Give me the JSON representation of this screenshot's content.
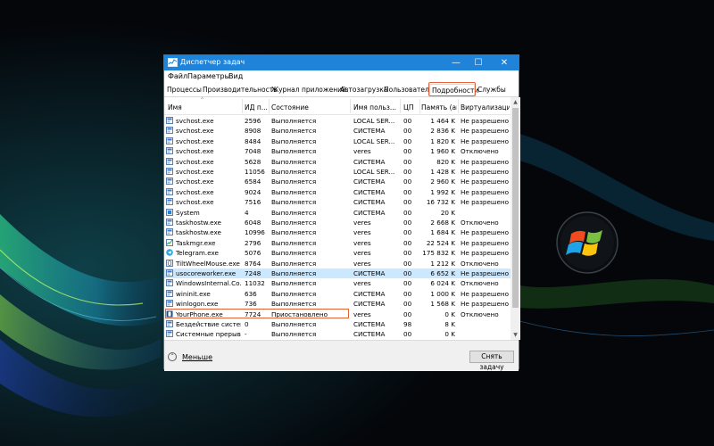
{
  "window": {
    "title": "Диспетчер задач",
    "accent_color": "#1e83d9",
    "controls": {
      "minimize": "—",
      "maximize": "☐",
      "close": "✕"
    }
  },
  "menu": [
    "Файл",
    "Параметры",
    "Вид"
  ],
  "tabs": [
    "Процессы",
    "Производительность",
    "Журнал приложений",
    "Автозагрузка",
    "Пользователи",
    "Подробности",
    "Службы"
  ],
  "active_tab": "Подробности",
  "highlight_color": "#e0633a",
  "columns": [
    "Имя",
    "ИД п...",
    "Состояние",
    "Имя польз...",
    "ЦП",
    "Память (ак...",
    "Виртуализаци..."
  ],
  "rows": [
    {
      "name": "svchost.exe",
      "pid": "2596",
      "state": "Выполняется",
      "user": "LOCAL SER...",
      "cpu": "00",
      "mem": "1 464 K",
      "virt": "Не разрешено",
      "icon": "service-icon"
    },
    {
      "name": "svchost.exe",
      "pid": "8908",
      "state": "Выполняется",
      "user": "СИСТЕМА",
      "cpu": "00",
      "mem": "2 836 K",
      "virt": "Не разрешено",
      "icon": "service-icon"
    },
    {
      "name": "svchost.exe",
      "pid": "8484",
      "state": "Выполняется",
      "user": "LOCAL SER...",
      "cpu": "00",
      "mem": "1 820 K",
      "virt": "Не разрешено",
      "icon": "service-icon"
    },
    {
      "name": "svchost.exe",
      "pid": "7048",
      "state": "Выполняется",
      "user": "veres",
      "cpu": "00",
      "mem": "1 960 K",
      "virt": "Отключено",
      "icon": "service-icon"
    },
    {
      "name": "svchost.exe",
      "pid": "5628",
      "state": "Выполняется",
      "user": "СИСТЕМА",
      "cpu": "00",
      "mem": "820 K",
      "virt": "Не разрешено",
      "icon": "service-icon"
    },
    {
      "name": "svchost.exe",
      "pid": "11056",
      "state": "Выполняется",
      "user": "LOCAL SER...",
      "cpu": "00",
      "mem": "1 428 K",
      "virt": "Не разрешено",
      "icon": "service-icon"
    },
    {
      "name": "svchost.exe",
      "pid": "6584",
      "state": "Выполняется",
      "user": "СИСТЕМА",
      "cpu": "00",
      "mem": "2 960 K",
      "virt": "Не разрешено",
      "icon": "service-icon"
    },
    {
      "name": "svchost.exe",
      "pid": "9024",
      "state": "Выполняется",
      "user": "СИСТЕМА",
      "cpu": "00",
      "mem": "1 992 K",
      "virt": "Не разрешено",
      "icon": "service-icon"
    },
    {
      "name": "svchost.exe",
      "pid": "7516",
      "state": "Выполняется",
      "user": "СИСТЕМА",
      "cpu": "00",
      "mem": "16 732 K",
      "virt": "Не разрешено",
      "icon": "service-icon"
    },
    {
      "name": "System",
      "pid": "4",
      "state": "Выполняется",
      "user": "СИСТЕМА",
      "cpu": "00",
      "mem": "20 K",
      "virt": "",
      "icon": "system-icon"
    },
    {
      "name": "taskhostw.exe",
      "pid": "6048",
      "state": "Выполняется",
      "user": "veres",
      "cpu": "00",
      "mem": "2 668 K",
      "virt": "Отключено",
      "icon": "service-icon"
    },
    {
      "name": "taskhostw.exe",
      "pid": "10996",
      "state": "Выполняется",
      "user": "veres",
      "cpu": "00",
      "mem": "1 684 K",
      "virt": "Не разрешено",
      "icon": "service-icon"
    },
    {
      "name": "Taskmgr.exe",
      "pid": "2796",
      "state": "Выполняется",
      "user": "veres",
      "cpu": "00",
      "mem": "22 524 K",
      "virt": "Не разрешено",
      "icon": "taskmgr-icon"
    },
    {
      "name": "Telegram.exe",
      "pid": "5076",
      "state": "Выполняется",
      "user": "veres",
      "cpu": "00",
      "mem": "175 832 K",
      "virt": "Не разрешено",
      "icon": "telegram-icon"
    },
    {
      "name": "TiltWheelMouse.exe",
      "pid": "8764",
      "state": "Выполняется",
      "user": "veres",
      "cpu": "00",
      "mem": "1 212 K",
      "virt": "Отключено",
      "icon": "mouse-icon"
    },
    {
      "name": "usocoreworker.exe",
      "pid": "7248",
      "state": "Выполняется",
      "user": "СИСТЕМА",
      "cpu": "00",
      "mem": "6 652 K",
      "virt": "Не разрешено",
      "icon": "service-icon",
      "selected": true
    },
    {
      "name": "WindowsInternal.Co...",
      "pid": "11032",
      "state": "Выполняется",
      "user": "veres",
      "cpu": "00",
      "mem": "6 024 K",
      "virt": "Отключено",
      "icon": "service-icon"
    },
    {
      "name": "wininit.exe",
      "pid": "636",
      "state": "Выполняется",
      "user": "СИСТЕМА",
      "cpu": "00",
      "mem": "1 000 K",
      "virt": "Не разрешено",
      "icon": "service-icon"
    },
    {
      "name": "winlogon.exe",
      "pid": "736",
      "state": "Выполняется",
      "user": "СИСТЕМА",
      "cpu": "00",
      "mem": "1 568 K",
      "virt": "Не разрешено",
      "icon": "service-icon"
    },
    {
      "name": "YourPhone.exe",
      "pid": "7724",
      "state": "Приостановлено",
      "user": "veres",
      "cpu": "00",
      "mem": "0 K",
      "virt": "Отключено",
      "icon": "phone-icon"
    },
    {
      "name": "Бездействие системы",
      "pid": "0",
      "state": "Выполняется",
      "user": "СИСТЕМА",
      "cpu": "98",
      "mem": "8 K",
      "virt": "",
      "icon": "service-icon"
    },
    {
      "name": "Системные прерыв...",
      "pid": "-",
      "state": "Выполняется",
      "user": "СИСТЕМА",
      "cpu": "00",
      "mem": "0 K",
      "virt": "",
      "icon": "service-icon"
    }
  ],
  "footer": {
    "less_label": "Меньше",
    "end_task_label": "Снять задачу"
  }
}
